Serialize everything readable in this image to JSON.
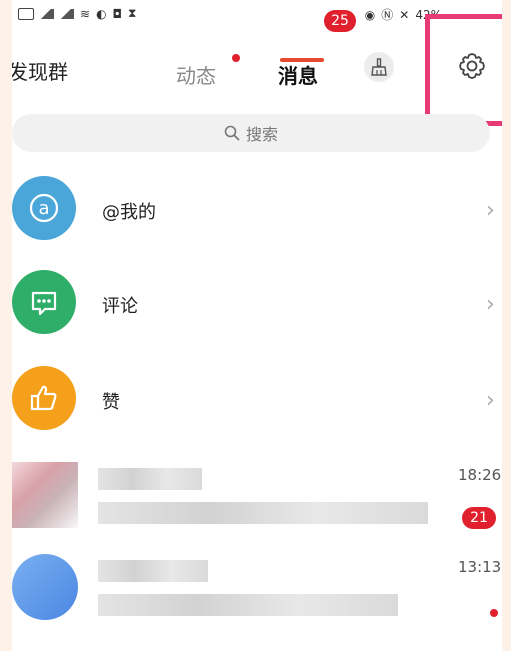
{
  "status_bar": {
    "battery": "42%"
  },
  "header": {
    "left_title": "发现群",
    "tabs": [
      {
        "label": "动态",
        "has_dot": true
      },
      {
        "label": "消息",
        "active": true,
        "badge": "25"
      }
    ],
    "icons": [
      "broom-icon",
      "gear-icon"
    ]
  },
  "search": {
    "placeholder": "搜索"
  },
  "menu_rows": [
    {
      "label": "@我的",
      "icon": "at-icon",
      "color": "#4aa6d9"
    },
    {
      "label": "评论",
      "icon": "comment-icon",
      "color": "#2fae69"
    },
    {
      "label": "赞",
      "icon": "thumbs-up-icon",
      "color": "#f5a01a"
    }
  ],
  "conversations": [
    {
      "time": "18:26",
      "unread": "21"
    },
    {
      "time": "13:13",
      "has_dot": true
    }
  ],
  "colors": {
    "accent_red": "#e0202c",
    "highlight_pink": "#e83a74"
  }
}
